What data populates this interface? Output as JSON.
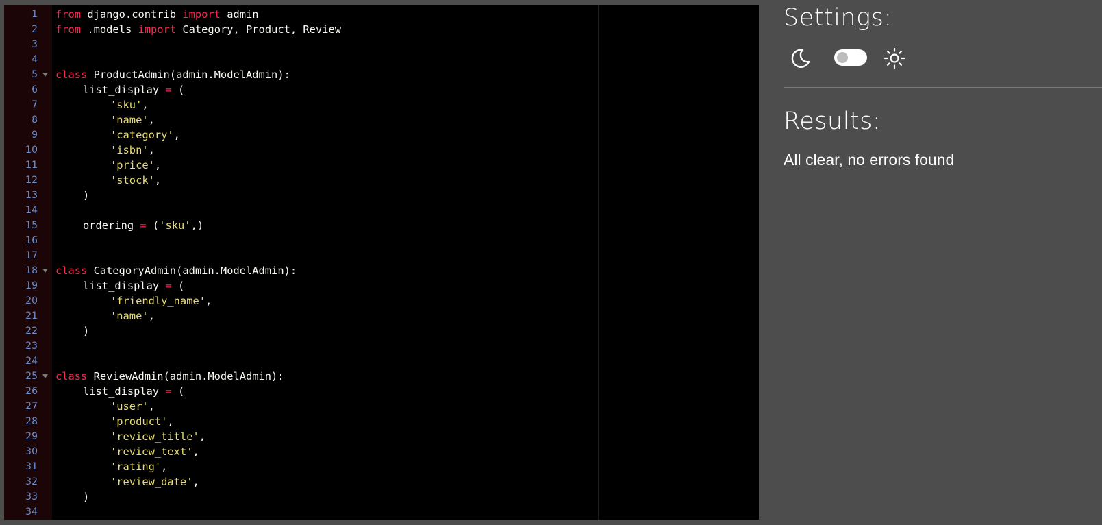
{
  "editor": {
    "lines": [
      {
        "n": "1",
        "tokens": [
          [
            "kw",
            "from"
          ],
          [
            "id",
            " django.contrib "
          ],
          [
            "kw",
            "import"
          ],
          [
            "id",
            " admin"
          ]
        ]
      },
      {
        "n": "2",
        "tokens": [
          [
            "kw",
            "from"
          ],
          [
            "id",
            " .models "
          ],
          [
            "kw",
            "import"
          ],
          [
            "id",
            " Category, Product, Review"
          ]
        ]
      },
      {
        "n": "3",
        "tokens": []
      },
      {
        "n": "4",
        "tokens": []
      },
      {
        "n": "5",
        "fold": true,
        "tokens": [
          [
            "kw",
            "class"
          ],
          [
            "id",
            " ProductAdmin(admin.ModelAdmin):"
          ]
        ]
      },
      {
        "n": "6",
        "indent": 1,
        "tokens": [
          [
            "id",
            "list_display "
          ],
          [
            "op",
            "="
          ],
          [
            "id",
            " ("
          ]
        ]
      },
      {
        "n": "7",
        "indent": 2,
        "tokens": [
          [
            "str",
            "'sku'"
          ],
          [
            "id",
            ","
          ]
        ]
      },
      {
        "n": "8",
        "indent": 2,
        "tokens": [
          [
            "str",
            "'name'"
          ],
          [
            "id",
            ","
          ]
        ]
      },
      {
        "n": "9",
        "indent": 2,
        "tokens": [
          [
            "str",
            "'category'"
          ],
          [
            "id",
            ","
          ]
        ]
      },
      {
        "n": "10",
        "indent": 2,
        "tokens": [
          [
            "str",
            "'isbn'"
          ],
          [
            "id",
            ","
          ]
        ]
      },
      {
        "n": "11",
        "indent": 2,
        "tokens": [
          [
            "str",
            "'price'"
          ],
          [
            "id",
            ","
          ]
        ]
      },
      {
        "n": "12",
        "indent": 2,
        "tokens": [
          [
            "str",
            "'stock'"
          ],
          [
            "id",
            ","
          ]
        ]
      },
      {
        "n": "13",
        "indent": 1,
        "tokens": [
          [
            "id",
            ")"
          ]
        ]
      },
      {
        "n": "14",
        "tokens": []
      },
      {
        "n": "15",
        "indent": 1,
        "tokens": [
          [
            "id",
            "ordering "
          ],
          [
            "op",
            "="
          ],
          [
            "id",
            " ("
          ],
          [
            "str",
            "'sku'"
          ],
          [
            "id",
            ",)"
          ]
        ]
      },
      {
        "n": "16",
        "tokens": []
      },
      {
        "n": "17",
        "tokens": []
      },
      {
        "n": "18",
        "fold": true,
        "tokens": [
          [
            "kw",
            "class"
          ],
          [
            "id",
            " CategoryAdmin(admin.ModelAdmin):"
          ]
        ]
      },
      {
        "n": "19",
        "indent": 1,
        "tokens": [
          [
            "id",
            "list_display "
          ],
          [
            "op",
            "="
          ],
          [
            "id",
            " ("
          ]
        ]
      },
      {
        "n": "20",
        "indent": 2,
        "tokens": [
          [
            "str",
            "'friendly_name'"
          ],
          [
            "id",
            ","
          ]
        ]
      },
      {
        "n": "21",
        "indent": 2,
        "tokens": [
          [
            "str",
            "'name'"
          ],
          [
            "id",
            ","
          ]
        ]
      },
      {
        "n": "22",
        "indent": 1,
        "tokens": [
          [
            "id",
            ")"
          ]
        ]
      },
      {
        "n": "23",
        "tokens": []
      },
      {
        "n": "24",
        "tokens": []
      },
      {
        "n": "25",
        "fold": true,
        "tokens": [
          [
            "kw",
            "class"
          ],
          [
            "id",
            " ReviewAdmin(admin.ModelAdmin):"
          ]
        ]
      },
      {
        "n": "26",
        "indent": 1,
        "tokens": [
          [
            "id",
            "list_display "
          ],
          [
            "op",
            "="
          ],
          [
            "id",
            " ("
          ]
        ]
      },
      {
        "n": "27",
        "indent": 2,
        "tokens": [
          [
            "str",
            "'user'"
          ],
          [
            "id",
            ","
          ]
        ]
      },
      {
        "n": "28",
        "indent": 2,
        "tokens": [
          [
            "str",
            "'product'"
          ],
          [
            "id",
            ","
          ]
        ]
      },
      {
        "n": "29",
        "indent": 2,
        "tokens": [
          [
            "str",
            "'review_title'"
          ],
          [
            "id",
            ","
          ]
        ]
      },
      {
        "n": "30",
        "indent": 2,
        "tokens": [
          [
            "str",
            "'review_text'"
          ],
          [
            "id",
            ","
          ]
        ]
      },
      {
        "n": "31",
        "indent": 2,
        "tokens": [
          [
            "str",
            "'rating'"
          ],
          [
            "id",
            ","
          ]
        ]
      },
      {
        "n": "32",
        "indent": 2,
        "tokens": [
          [
            "str",
            "'review_date'"
          ],
          [
            "id",
            ","
          ]
        ]
      },
      {
        "n": "33",
        "indent": 1,
        "tokens": [
          [
            "id",
            ")"
          ]
        ]
      },
      {
        "n": "34",
        "tokens": []
      }
    ]
  },
  "settings": {
    "title": "Settings:",
    "theme_toggle": {
      "left_icon": "moon-icon",
      "right_icon": "sun-icon",
      "state": "off"
    }
  },
  "results": {
    "title": "Results:",
    "message": "All clear, no errors found"
  },
  "colors": {
    "background": "#4d4d4d",
    "editor_background": "#000000",
    "gutter_background": "#1b0507",
    "keyword": "#f92653",
    "string": "#e6db74",
    "identifier": "#f8f8f2",
    "line_number": "#6a8ed0"
  }
}
